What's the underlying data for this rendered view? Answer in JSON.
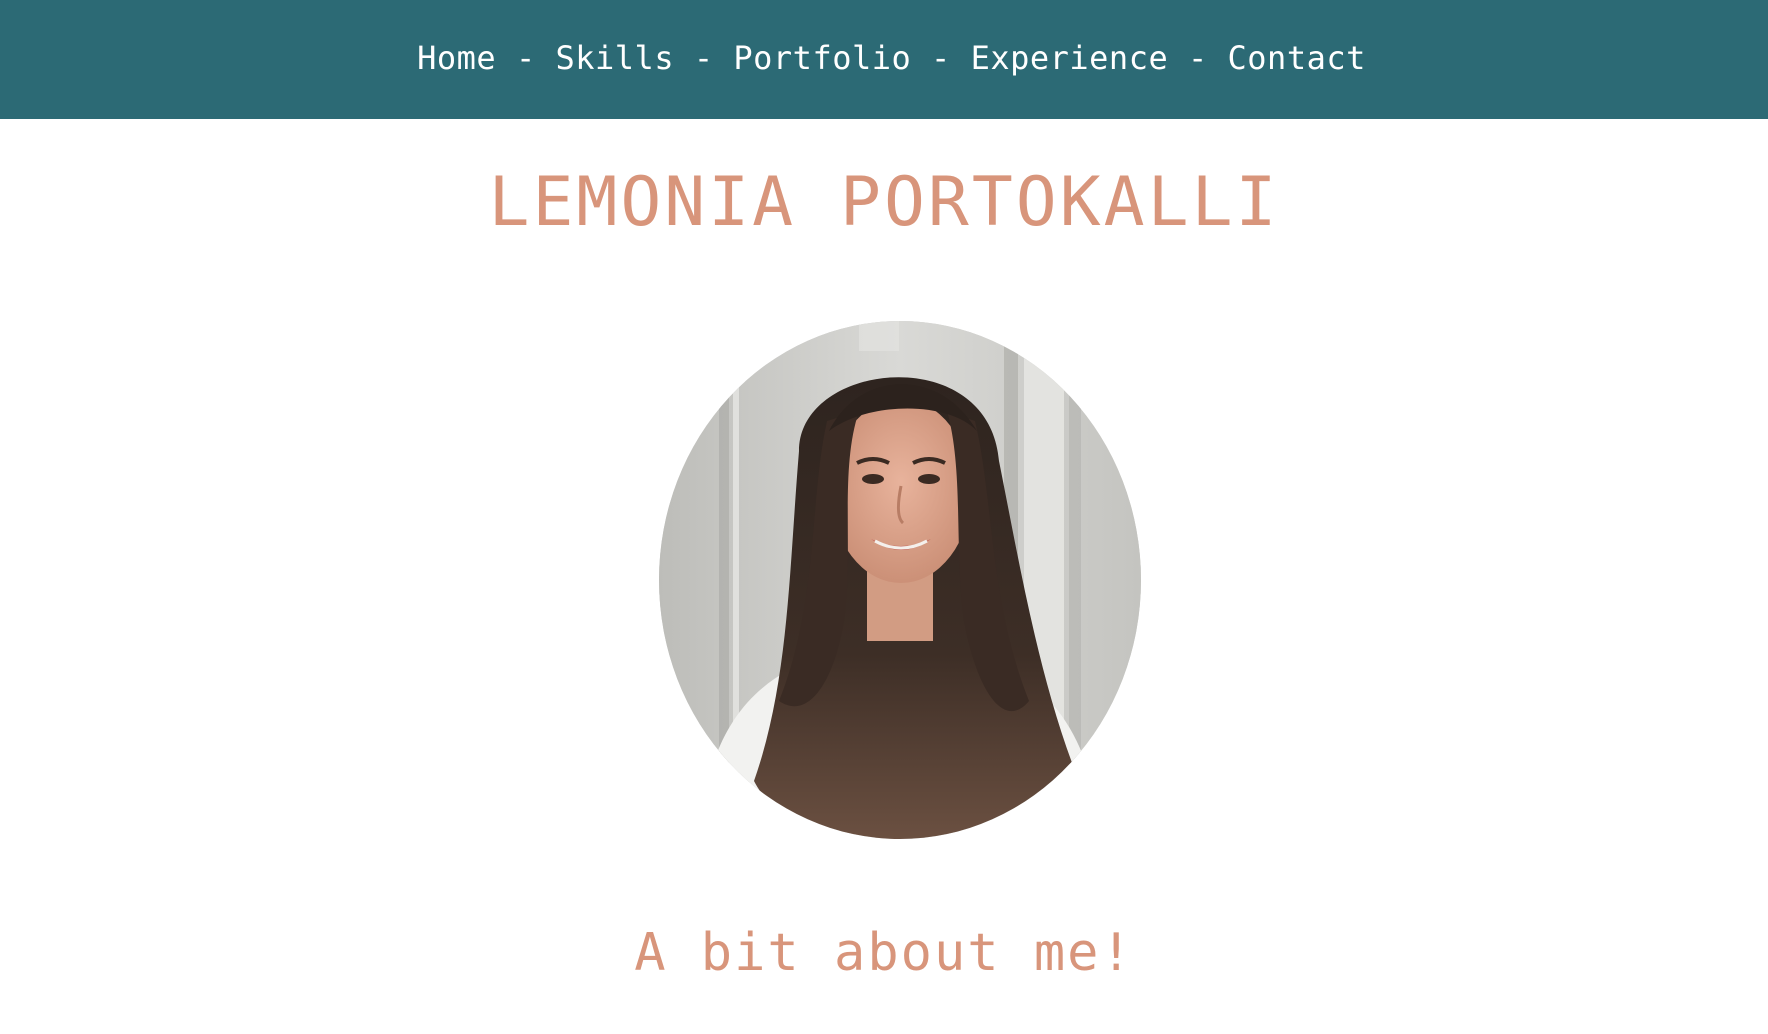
{
  "nav": {
    "items": [
      {
        "label": "Home"
      },
      {
        "label": "Skills"
      },
      {
        "label": "Portfolio"
      },
      {
        "label": "Experience"
      },
      {
        "label": "Contact"
      }
    ],
    "separator": " - "
  },
  "hero": {
    "name": "LEMONIA PORTOKALLI",
    "portrait_alt": "Profile photo of Lemonia Portokalli"
  },
  "about": {
    "heading": "A bit about me!"
  },
  "colors": {
    "nav_background": "#2c6a75",
    "nav_text": "#ffffff",
    "accent": "#d8957b",
    "page_background": "#ffffff"
  }
}
